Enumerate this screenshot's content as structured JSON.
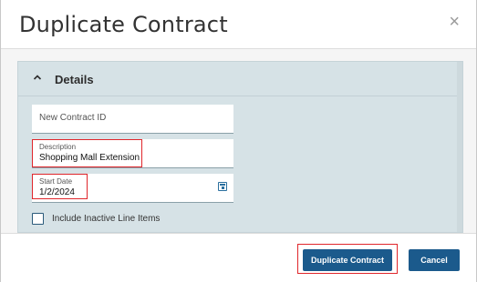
{
  "dialog": {
    "title": "Duplicate Contract",
    "close_glyph": "×"
  },
  "details": {
    "title": "Details",
    "contract_id_placeholder": "New Contract ID",
    "description_label": "Description",
    "description_value": "Shopping Mall Extension",
    "start_date_label": "Start Date",
    "start_date_value": "1/2/2024",
    "include_inactive_label": "Include Inactive Line Items",
    "include_inactive_checked": false
  },
  "footer": {
    "duplicate_label": "Duplicate Contract",
    "cancel_label": "Cancel"
  },
  "colors": {
    "accent": "#1b5a8c",
    "panel_bg": "#d6e2e6",
    "highlight": "#e0262b"
  },
  "icons": [
    "close-icon",
    "chevron-up-icon",
    "calendar-icon",
    "checkbox"
  ]
}
